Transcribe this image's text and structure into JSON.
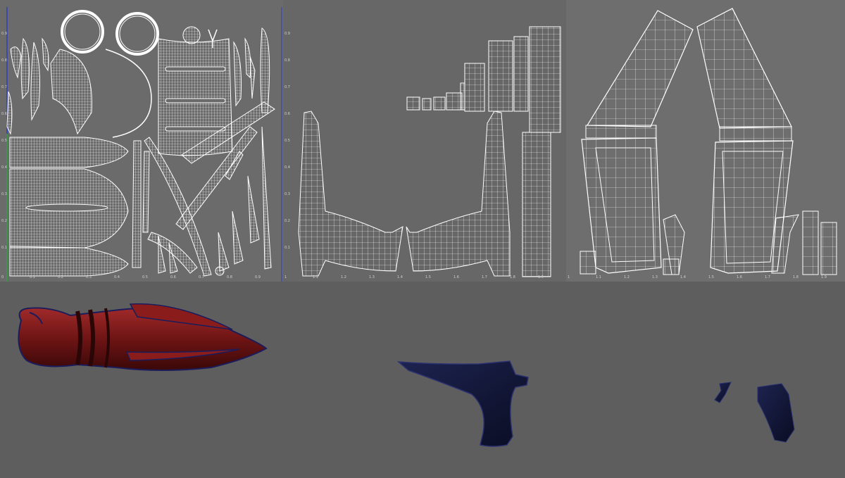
{
  "colors": {
    "wireframe": "#ffffff",
    "uv_background": "#6b6b6b",
    "viewport_background": "#5e5e5e",
    "model_red": "#7a1616",
    "model_navy": "#141a3c"
  },
  "uv_panels": [
    {
      "v_ticks": [
        "0.9",
        "0.8",
        "0.7",
        "0.6",
        "0.5",
        "0.4",
        "0.3",
        "0.2",
        "0.1"
      ],
      "u_ticks": [
        "0",
        "0.1",
        "0.2",
        "0.3",
        "0.4",
        "0.5",
        "0.6",
        "0.7",
        "0.8",
        "0.9"
      ]
    },
    {
      "v_ticks": [
        "0.9",
        "0.8",
        "0.7",
        "0.6",
        "0.5",
        "0.4",
        "0.3",
        "0.2",
        "0.1"
      ],
      "u_ticks": [
        "1",
        "1.1",
        "1.2",
        "1.3",
        "1.4",
        "1.5",
        "1.6",
        "1.7",
        "1.8",
        "1.9"
      ]
    },
    {
      "v_ticks": [],
      "u_ticks": [
        "1",
        "1.1",
        "1.2",
        "1.3",
        "1.4",
        "1.5",
        "1.6",
        "1.7",
        "1.8",
        "1.9"
      ]
    }
  ]
}
